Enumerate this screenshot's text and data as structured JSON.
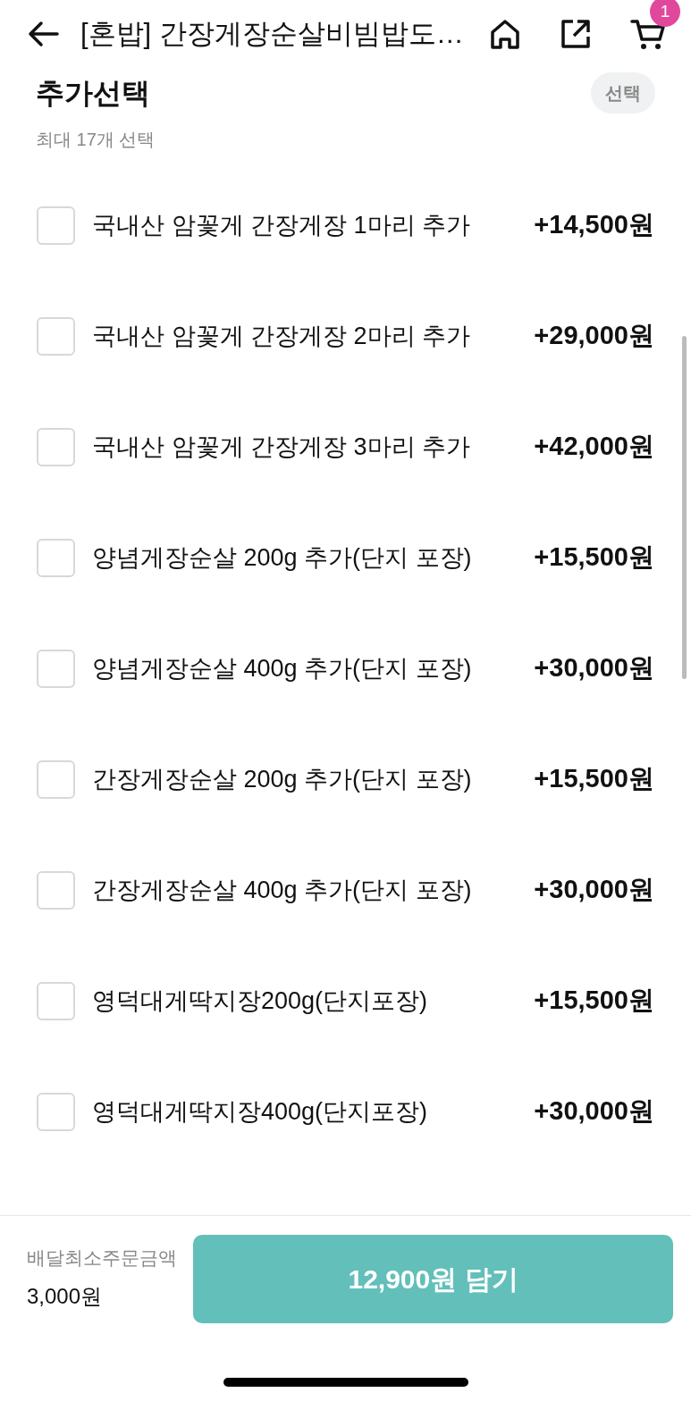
{
  "header": {
    "title": "[혼밥] 간장게장순살비빔밥도…",
    "cart_count": "1"
  },
  "section": {
    "title": "추가선택",
    "badge": "선택",
    "subtitle": "최대 17개 선택"
  },
  "options": [
    {
      "label": "국내산 암꽃게 간장게장 1마리 추가",
      "price": "+14,500원",
      "checked": false
    },
    {
      "label": "국내산 암꽃게 간장게장 2마리 추가",
      "price": "+29,000원",
      "checked": false
    },
    {
      "label": "국내산 암꽃게 간장게장 3마리 추가",
      "price": "+42,000원",
      "checked": false
    },
    {
      "label": "양념게장순살 200g 추가(단지 포장)",
      "price": "+15,500원",
      "checked": false
    },
    {
      "label": "양념게장순살 400g 추가(단지 포장)",
      "price": "+30,000원",
      "checked": false
    },
    {
      "label": "간장게장순살 200g 추가(단지 포장)",
      "price": "+15,500원",
      "checked": false
    },
    {
      "label": "간장게장순살 400g 추가(단지 포장)",
      "price": "+30,000원",
      "checked": false
    },
    {
      "label": "영덕대게딱지장200g(단지포장)",
      "price": "+15,500원",
      "checked": false
    },
    {
      "label": "영덕대게딱지장400g(단지포장)",
      "price": "+30,000원",
      "checked": false
    }
  ],
  "footer": {
    "min_order_label": "배달최소주문금액",
    "min_order_value": "3,000원",
    "add_button": "12,900원 담기"
  }
}
